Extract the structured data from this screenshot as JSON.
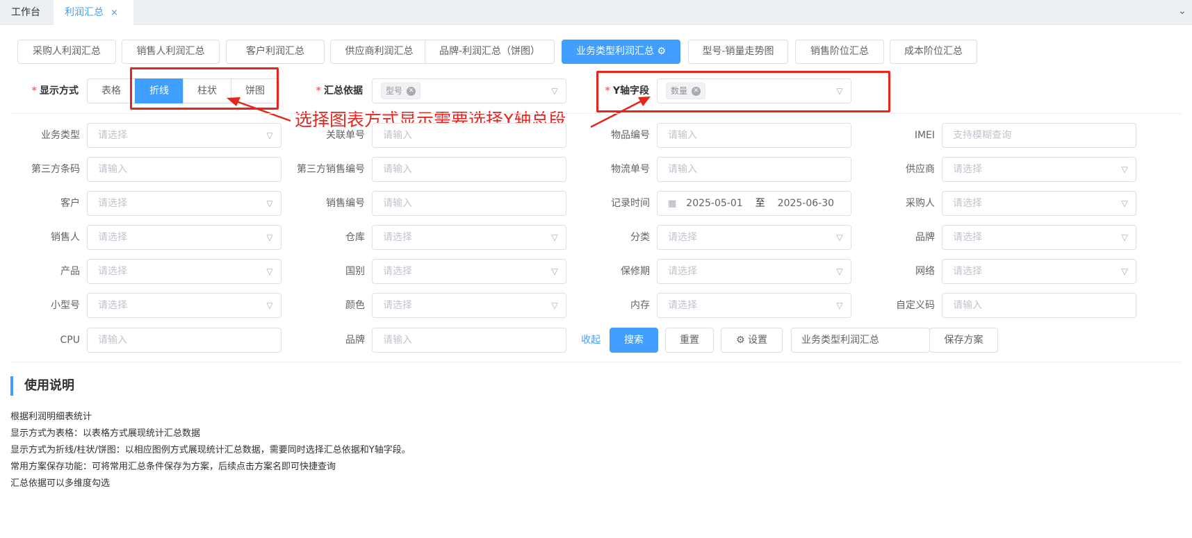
{
  "tabs": [
    {
      "label": "工作台"
    },
    {
      "label": "利润汇总",
      "close": "×"
    }
  ],
  "tabs_chevron": "⌄",
  "reports": [
    "采购人利润汇总",
    "销售人利润汇总",
    "客户利润汇总",
    "供应商利润汇总",
    "品牌-利润汇总（饼图）",
    "业务类型利润汇总",
    "型号-销量走势图",
    "销售阶位汇总",
    "成本阶位汇总"
  ],
  "active_report_icon": "gear-icon",
  "display": {
    "required": "*",
    "label": "显示方式",
    "options": [
      "表格",
      "折线",
      "柱状",
      "饼图"
    ],
    "selected": "折线"
  },
  "group_by": {
    "required": "*",
    "label": "汇总依据",
    "tag": "型号"
  },
  "y_axis": {
    "required": "*",
    "label": "Y轴字段",
    "tag": "数量"
  },
  "annotation": "选择图表方式显示需要选择Y轴总段",
  "filters": {
    "r0": [
      {
        "label": "业务类型",
        "ph": "请选择"
      },
      {
        "label": "关联单号",
        "ph": "请输入"
      },
      {
        "label": "物品编号",
        "ph": "请输入"
      },
      {
        "label": "IMEI",
        "ph": "支持模糊查询"
      }
    ],
    "r1": [
      {
        "label": "第三方条码",
        "ph": "请输入"
      },
      {
        "label": "第三方销售编号",
        "ph": "请输入"
      },
      {
        "label": "物流单号",
        "ph": "请输入"
      },
      {
        "label": "供应商",
        "ph": "请选择"
      }
    ],
    "r2": [
      {
        "label": "客户",
        "ph": "请选择"
      },
      {
        "label": "销售编号",
        "ph": "请输入"
      },
      {
        "label": "记录时间",
        "start": "2025-05-01",
        "sep": "至",
        "end": "2025-06-30"
      },
      {
        "label": "采购人",
        "ph": "请选择"
      }
    ],
    "r3": [
      {
        "label": "销售人",
        "ph": "请选择"
      },
      {
        "label": "仓库",
        "ph": "请选择"
      },
      {
        "label": "分类",
        "ph": "请选择"
      },
      {
        "label": "品牌",
        "ph": "请选择"
      }
    ],
    "r4": [
      {
        "label": "产品",
        "ph": "请选择"
      },
      {
        "label": "国别",
        "ph": "请选择"
      },
      {
        "label": "保修期",
        "ph": "请选择"
      },
      {
        "label": "网络",
        "ph": "请选择"
      }
    ],
    "r5": [
      {
        "label": "小型号",
        "ph": "请选择"
      },
      {
        "label": "颜色",
        "ph": "请选择"
      },
      {
        "label": "内存",
        "ph": "请选择"
      },
      {
        "label": "自定义码",
        "ph": "请输入"
      }
    ],
    "r6": [
      {
        "label": "CPU",
        "ph": "请输入"
      },
      {
        "label": "品牌",
        "ph": "请输入"
      }
    ]
  },
  "actions": {
    "collapse": "收起",
    "search": "搜索",
    "reset": "重置",
    "settings": "设置",
    "scheme_name": "业务类型利润汇总",
    "save_scheme": "保存方案"
  },
  "usage": {
    "title": "使用说明",
    "lines": [
      "根据利润明细表统计",
      "显示方式为表格：以表格方式展现统计汇总数据",
      "显示方式为折线/柱状/饼图：以相应图例方式展现统计汇总数据，需要同时选择汇总依据和Y轴字段。",
      "常用方案保存功能：可将常用汇总条件保存为方案，后续点击方案名即可快捷查询",
      "汇总依据可以多维度勾选"
    ]
  },
  "colors": {
    "primary": "#409eff",
    "annotation_red": "#e5251e"
  }
}
